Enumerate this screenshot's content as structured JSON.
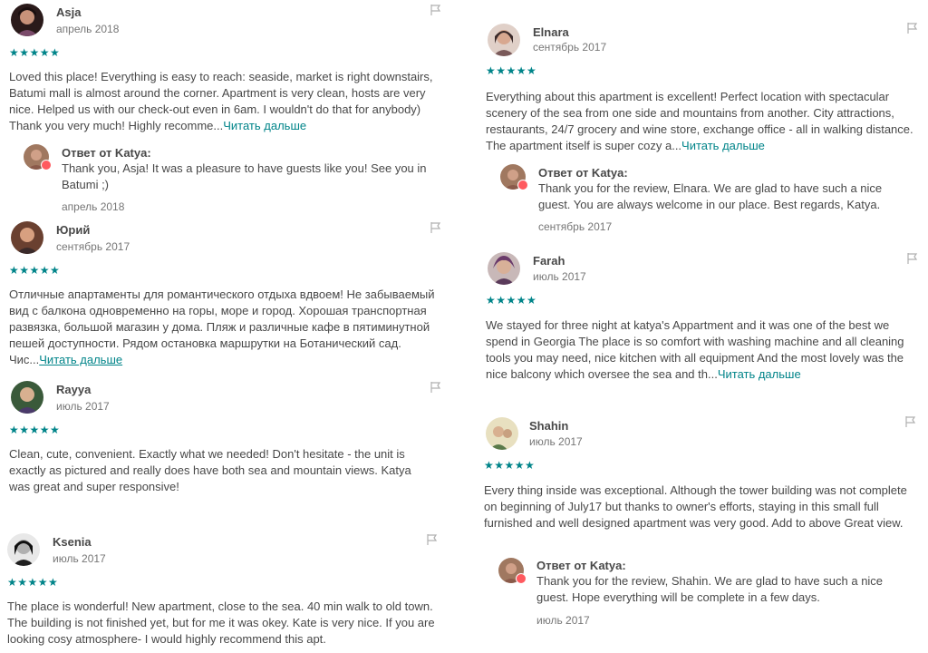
{
  "colors": {
    "accent": "#008489",
    "text": "#484848",
    "muted": "#767676",
    "badge": "#ff5a5f"
  },
  "stars": "★★★★★",
  "read_more": "Читать дальше",
  "response_title": "Ответ от Katya:",
  "reviews": [
    {
      "name": "Asja",
      "date": "апрель 2018",
      "text": "Loved this place! Everything is easy to reach: seaside, market is right downstairs, Batumi mall is almost around the corner. Apartment is very clean, hosts are very nice. Helped us with our check-out even in 6am. I wouldn't do that for anybody) Thank you very much! Highly recomme...",
      "response": {
        "text": "Thank you, Asja! It was a pleasure to have guests like you! See you in Batumi ;)",
        "date": "апрель 2018"
      }
    },
    {
      "name": "Юрий",
      "date": "сентябрь 2017",
      "text": "Отличные апартаменты для романтического отдыха вдвоем! Не забываемый вид с балкона одновременно на горы, море и город. Хорошая транспортная развязка, большой магазин у дома. Пляж и различные кафе в пятиминутной пешей доступности. Рядом остановка маршрутки на Ботанический сад. Чис..."
    },
    {
      "name": "Rayya",
      "date": "июль 2017",
      "text": "Clean, cute, convenient. Exactly what we needed! Don't hesitate - the unit is exactly as pictured and really does have both sea and mountain views. Katya was great and super responsive!"
    },
    {
      "name": "Ksenia",
      "date": "июль 2017",
      "text": "The place is wonderful! New apartment, close to the sea. 40 min walk to old town. The building is not finished yet, but for me it was okey. Kate is very nice. If you are looking cosy atmosphere- I would highly recommend this apt."
    },
    {
      "name": "Elnara",
      "date": "сентябрь 2017",
      "text": "Everything about this apartment is excellent! Perfect location with spectacular scenery of the sea from one side and mountains from another. City attractions, restaurants, 24/7 grocery and wine store, exchange office - all in walking distance. The apartment itself is super cozy a...",
      "response": {
        "text": "Thank you for the review, Elnara. We are glad to have such a nice guest. You are always welcome in our place. Best regards, Katya.",
        "date": "сентябрь 2017"
      }
    },
    {
      "name": "Farah",
      "date": "июль 2017",
      "text": "We stayed for three night at katya's Appartment and it was one of the best we spend in Georgia The place is so comfort with washing machine and all cleaning tools you may need, nice kitchen with all equipment And the most lovely was the nice balcony which oversee the sea and th..."
    },
    {
      "name": "Shahin",
      "date": "июль 2017",
      "text": "Every thing inside was exceptional. Although the tower building was not complete on beginning of July17 but thanks to owner's efforts, staying in this small full furnished and well designed apartment was very good. Add to above Great view.",
      "response": {
        "text": "Thank you for the review, Shahin. We are glad to have such a nice guest. Hope everything will be complete in a few days.",
        "date": "июль 2017"
      }
    }
  ]
}
